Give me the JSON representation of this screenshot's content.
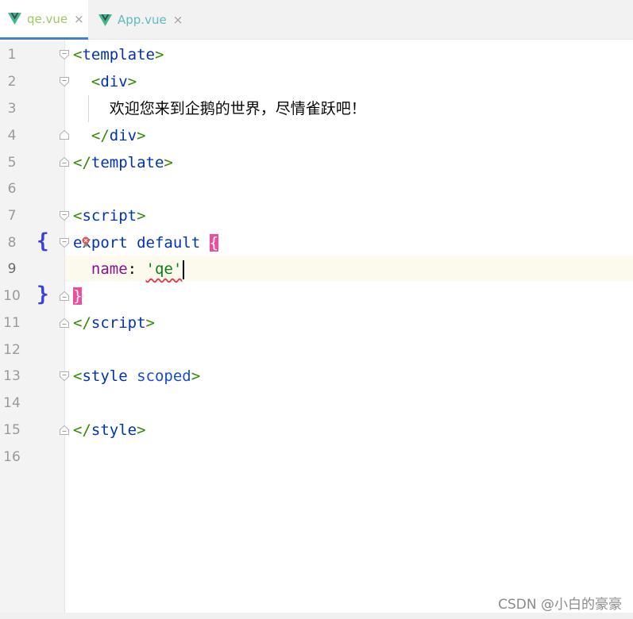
{
  "tabs": [
    {
      "label": "qe.vue",
      "close": "×",
      "active": true
    },
    {
      "label": "App.vue",
      "close": "×",
      "active": false
    }
  ],
  "colors": {
    "tag": "#0033b3",
    "bracket": "#2e8c00",
    "keyword": "#0033b3",
    "property": "#871094",
    "string": "#067d17",
    "match_highlight": "#ed4d9b",
    "gutter_brace": "#3a43d6",
    "current_line": "#fcfaed",
    "vue_green": "#41b883"
  },
  "gutter": {
    "line_numbers": [
      "1",
      "2",
      "3",
      "4",
      "5",
      "6",
      "7",
      "8",
      "9",
      "10",
      "11",
      "12",
      "13",
      "14",
      "15",
      "16"
    ],
    "open_brace": "{",
    "close_brace": "}"
  },
  "code": {
    "line1": {
      "open": "<",
      "tag": "template",
      "close": ">"
    },
    "line2": {
      "indent": "  ",
      "open": "<",
      "tag": "div",
      "close": ">"
    },
    "line3": {
      "indent": "    ",
      "text": "欢迎您来到企鹅的世界，尽情雀跃吧！"
    },
    "line4": {
      "indent": "  ",
      "open": "</",
      "tag": "div",
      "close": ">"
    },
    "line5": {
      "open": "</",
      "tag": "template",
      "close": ">"
    },
    "line7": {
      "open": "<",
      "tag": "script",
      "close": ">"
    },
    "line8": {
      "kw1": "export",
      "space": " ",
      "kw2": "default",
      "space2": " ",
      "brace": "{"
    },
    "line9": {
      "indent": "  ",
      "prop": "name",
      "colon": ": ",
      "str": "'qe'"
    },
    "line10": {
      "brace": "}"
    },
    "line11": {
      "open": "</",
      "tag": "script",
      "close": ">"
    },
    "line13": {
      "open": "<",
      "tag": "style",
      "space": " ",
      "attr": "scoped",
      "close": ">"
    },
    "line15": {
      "open": "</",
      "tag": "style",
      "close": ">"
    }
  },
  "watermark": "CSDN @小白的豪豪"
}
